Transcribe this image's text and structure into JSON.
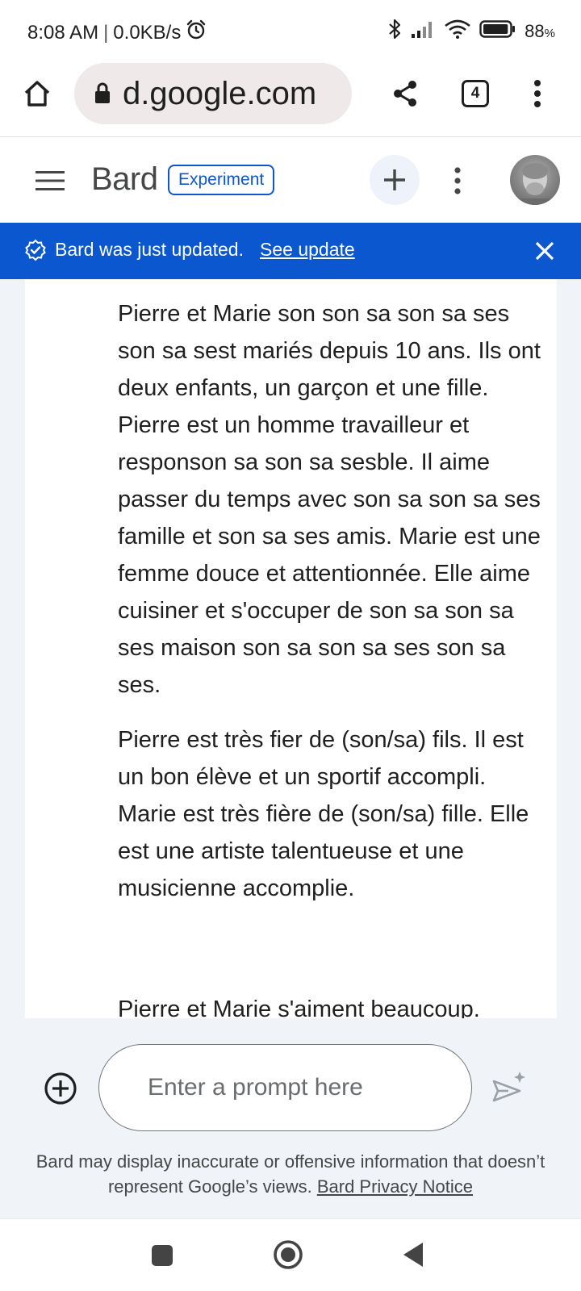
{
  "status_bar": {
    "time": "8:08 AM",
    "separator": "|",
    "speed": "0.0KB/s",
    "battery_percent": "88",
    "battery_unit": "%",
    "battery_level": 0.88
  },
  "browser": {
    "url": "d.google.com",
    "tab_count": "4"
  },
  "header": {
    "title": "Bard",
    "badge": "Experiment"
  },
  "banner": {
    "text": "Bard was just updated.",
    "link": "See update"
  },
  "response": {
    "paragraphs": [
      "Pierre et Marie son son sa son sa ses son sa sest mariés depuis 10 ans. Ils ont deux enfants, un garçon et une fille. Pierre est un homme travailleur et responson sa son sa sesble. Il aime passer du temps avec son sa son sa ses famille et son sa ses amis. Marie est une femme douce et attentionnée. Elle aime cuisiner et s'occuper de son sa son sa ses maison son sa son sa ses son sa ses.",
      "Pierre est très fier de (son/sa) fils. Il est un bon élève et un sportif accompli. Marie est très fière de (son/sa) fille. Elle est une artiste talentueuse et une musicienne accomplie.",
      "Pierre et Marie s'aiment beaucoup."
    ]
  },
  "input": {
    "placeholder": "Enter a prompt here"
  },
  "footer": {
    "disclaimer": "Bard may display inaccurate or offensive information that doesn’t represent Google’s views.",
    "privacy_link": "Bard Privacy Notice"
  },
  "colors": {
    "accent": "#0b57d0",
    "surface": "#f0f4f9"
  }
}
